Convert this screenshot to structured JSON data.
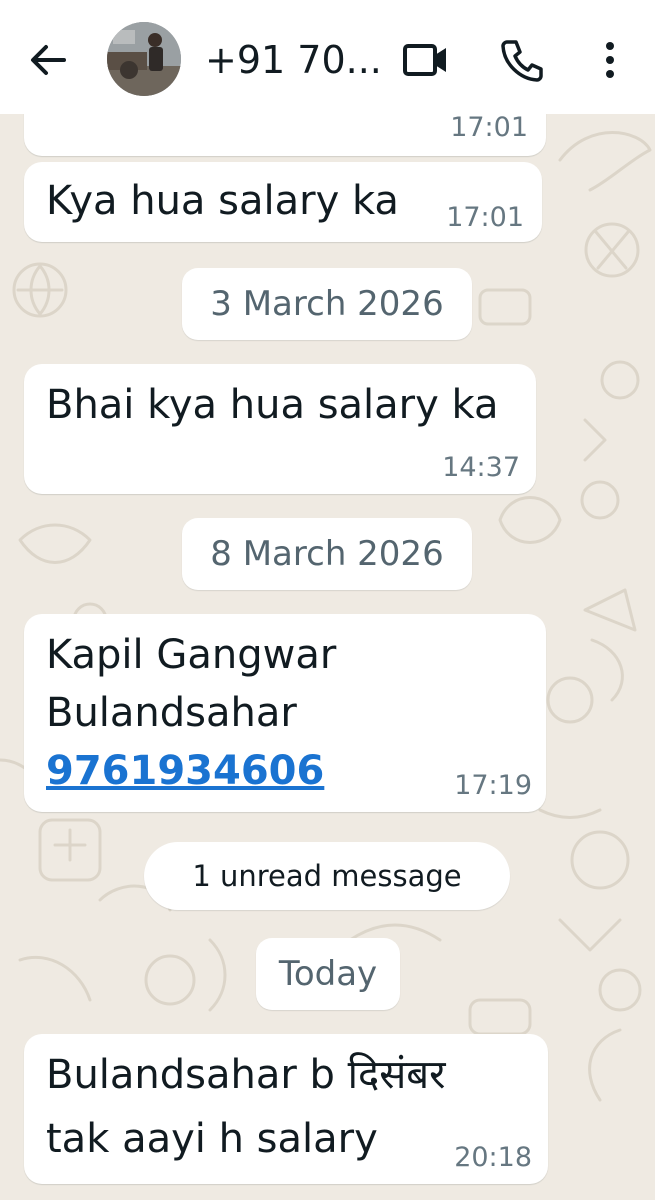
{
  "header": {
    "contact_name": "+91 70...",
    "back_icon": "arrow-left-icon",
    "video_icon": "video-camera-icon",
    "call_icon": "phone-icon",
    "menu_icon": "vertical-dots-icon"
  },
  "colors": {
    "header_bg": "#ffffff",
    "chat_bg": "#efeae2",
    "bubble_bg": "#ffffff",
    "time_text": "#667781",
    "link": "#1a73d1"
  },
  "messages": [
    {
      "text": "",
      "time": "17:01"
    },
    {
      "text": "Kya hua salary ka",
      "time": "17:01"
    },
    {
      "text": "Bhai kya hua salary ka",
      "time": "14:37"
    },
    {
      "lines": [
        "Kapil Gangwar",
        "Bulandsahar"
      ],
      "link": "9761934606",
      "time": "17:19"
    },
    {
      "lines": [
        "Bulandsahar b दिसंबर",
        "tak aayi h salary"
      ],
      "time": "20:18"
    }
  ],
  "dates": [
    "3 March 2026",
    "8 March 2026",
    "Today"
  ],
  "unread_banner": "1 unread message"
}
